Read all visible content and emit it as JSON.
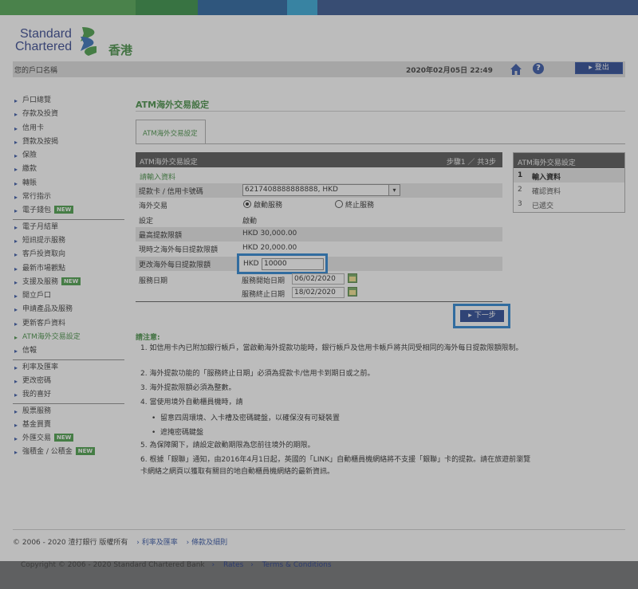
{
  "brand": {
    "line1": "Standard",
    "line2": "Chartered",
    "region": "香港"
  },
  "colors": {
    "stripe1": "#48a24a",
    "stripe2": "#2a8a3a",
    "stripe3": "#1c5b9a",
    "stripe4": "#2aa4d6",
    "stripe5": "#2b4d8a",
    "accent_green": "#3c8a3c",
    "navy": "#1e3e8e",
    "highlight": "#1f7fd0"
  },
  "header": {
    "account_label": "您的戶口名稱",
    "datetime": "2020年02月05日 22:49",
    "logout": "登出",
    "home_icon": "home-icon",
    "help_icon": "help-icon"
  },
  "sidebar": {
    "items": [
      {
        "label": "戶口總覽"
      },
      {
        "label": "存款及投資"
      },
      {
        "label": "信用卡"
      },
      {
        "label": "貸款及按揭"
      },
      {
        "label": "保險"
      },
      {
        "label": "繳款"
      },
      {
        "label": "轉賬"
      },
      {
        "label": "常行指示"
      },
      {
        "label": "電子錢包",
        "badge": "NEW"
      },
      {
        "label": "電子月結單"
      },
      {
        "label": "短訊提示服務"
      },
      {
        "label": "客戶投資取向"
      },
      {
        "label": "最新市場觀點"
      },
      {
        "label": "支援及服務",
        "badge": "NEW"
      },
      {
        "label": "開立戶口"
      },
      {
        "label": "申請產品及服務"
      },
      {
        "label": "更新客戶資料"
      },
      {
        "label": "ATM海外交易設定"
      },
      {
        "label": "信報"
      },
      {
        "label": "利率及匯率"
      },
      {
        "label": "更改密碼"
      },
      {
        "label": "我的喜好"
      },
      {
        "label": "股票服務"
      },
      {
        "label": "基金買賣"
      },
      {
        "label": "外匯交易",
        "badge": "NEW"
      },
      {
        "label": "強積金 / 公積金",
        "badge": "NEW"
      }
    ]
  },
  "main": {
    "title": "ATM海外交易設定",
    "tab": "ATM海外交易設定",
    "form_title": "ATM海外交易設定",
    "step_info": "步驟1 ／ 共3步",
    "section_label": "請輸入資料",
    "card_label": "提款卡 / 信用卡號碼",
    "card_value": "6217408888888888, HKD",
    "overseas_label": "海外交易",
    "opt_on": "啟動服務",
    "opt_off": "終止服務",
    "setting_label": "設定",
    "setting_value": "啟動",
    "max_label": "最高提款限額",
    "max_value": "HKD 30,000.00",
    "current_label": "現時之海外每日提款限額",
    "current_value": "HKD 20,000.00",
    "change_label": "更改海外每日提款限額",
    "change_currency": "HKD",
    "change_value": "10000",
    "service_label": "服務日期",
    "start_label": "服務開始日期",
    "start_value": "06/02/2020",
    "end_label": "服務終止日期",
    "end_value": "18/02/2020",
    "next_button": "下一步"
  },
  "steps": {
    "title": "ATM海外交易設定",
    "items": [
      {
        "n": "1",
        "label": "輸入資料"
      },
      {
        "n": "2",
        "label": "確認資料"
      },
      {
        "n": "3",
        "label": "已遞交"
      }
    ]
  },
  "notes": {
    "title": "請注意:",
    "items": [
      "1. 如信用卡內已附加銀行帳戶，當啟動海外提款功能時，銀行帳戶及信用卡帳戶將共同受相同的海外每日提款限額限制。",
      "2. 海外提款功能的「服務終止日期」必須為提款卡/信用卡到期日或之前。",
      "3. 海外提款限額必須為整數。",
      "4. 當使用境外自動櫃員機時，請",
      "5. 為保障閣下，請設定啟動期限為您前往境外的期限。",
      "6. 根據「銀聯」通知，由2016年4月1日起，英國的「LINK」自動櫃員機網絡將不支援「銀聯」卡的提款。請在旅遊前瀏覽卡網絡之網頁以獲取有關目的地自動櫃員機網絡的最新資訊。"
    ],
    "bullets": [
      "留意四周環境、入卡槽及密碼鍵盤，以確保沒有可疑裝置",
      "遮掩密碼鍵盤"
    ]
  },
  "footer": {
    "copyright": "© 2006 - 2020 渣打銀行 版權所有",
    "link1": "利率及匯率",
    "link2": "條款及細則"
  },
  "bottom": {
    "copyright": "Copyright © 2006 - 2020 Standard Chartered Bank",
    "link1": "Rates",
    "link2": "Terms & Conditions"
  }
}
